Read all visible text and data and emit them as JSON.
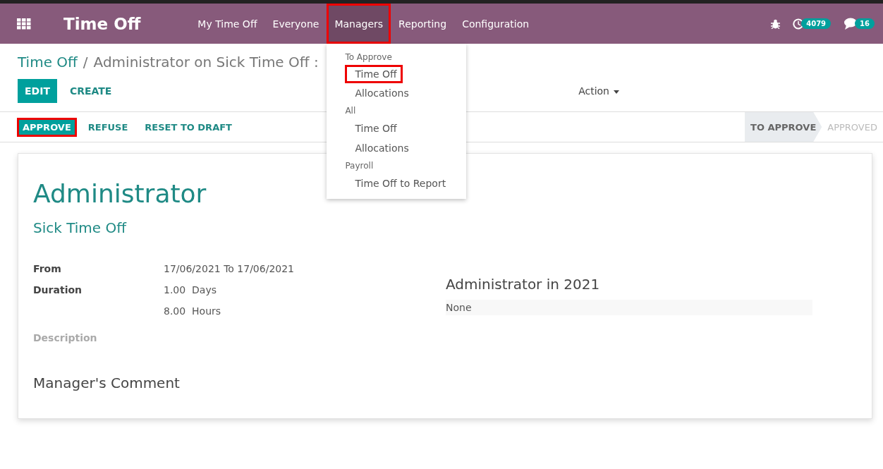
{
  "navbar": {
    "app_title": "Time Off",
    "menu": [
      {
        "label": "My Time Off",
        "open": false,
        "highlighted": false
      },
      {
        "label": "Everyone",
        "open": false,
        "highlighted": false
      },
      {
        "label": "Managers",
        "open": true,
        "highlighted": true
      },
      {
        "label": "Reporting",
        "open": false,
        "highlighted": false
      },
      {
        "label": "Configuration",
        "open": false,
        "highlighted": false
      }
    ],
    "activity_count": "4079",
    "message_count": "16"
  },
  "dropdown": {
    "sections": [
      {
        "header": "To Approve",
        "items": [
          {
            "label": "Time Off",
            "highlighted": true
          },
          {
            "label": "Allocations",
            "highlighted": false
          }
        ]
      },
      {
        "header": "All",
        "items": [
          {
            "label": "Time Off",
            "highlighted": false
          },
          {
            "label": "Allocations",
            "highlighted": false
          }
        ]
      },
      {
        "header": "Payroll",
        "items": [
          {
            "label": "Time Off to Report",
            "highlighted": false
          }
        ]
      }
    ]
  },
  "breadcrumb": {
    "parent": "Time Off",
    "separator": "/",
    "current": "Administrator on Sick Time Off :"
  },
  "buttons": [
    {
      "label": "EDIT",
      "kind": "primary"
    },
    {
      "label": "CREATE",
      "kind": "link"
    }
  ],
  "action": "Action",
  "status_buttons": [
    {
      "label": "APPROVE",
      "kind": "primary",
      "highlighted": true
    },
    {
      "label": "REFUSE",
      "kind": "link",
      "highlighted": false
    },
    {
      "label": "RESET TO DRAFT",
      "kind": "link",
      "highlighted": false
    }
  ],
  "stages": [
    {
      "label": "TO APPROVE",
      "selected": true
    },
    {
      "label": "APPROVED",
      "selected": false
    }
  ],
  "form": {
    "title": "Administrator",
    "subtitle": "Sick Time Off",
    "fields": [
      {
        "label": "From",
        "kind": "value",
        "values": [
          "17/06/2021 To 17/06/2021"
        ]
      },
      {
        "label": "Duration",
        "kind": "value",
        "values": [
          "1.00  Days",
          "8.00  Hours"
        ]
      },
      {
        "label": "Description",
        "kind": "empty"
      }
    ],
    "comment_heading": "Manager's Comment",
    "side": {
      "title": "Administrator in 2021",
      "value": "None"
    }
  }
}
